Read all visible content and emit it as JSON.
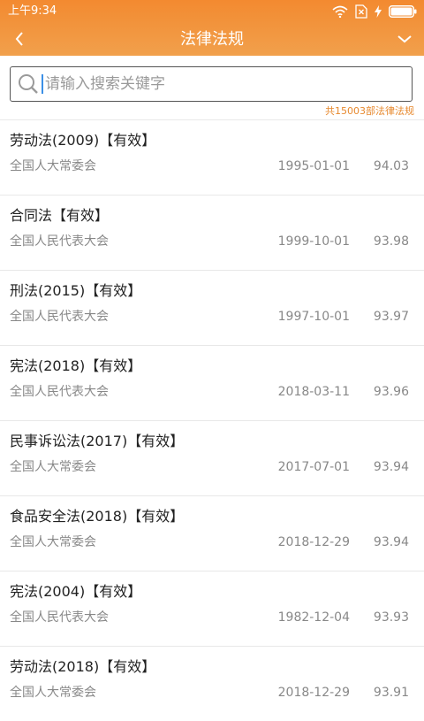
{
  "status_bar": {
    "time": "上午9:34",
    "icons": [
      "wifi-icon",
      "sim-error-icon",
      "charging-icon",
      "battery-icon"
    ]
  },
  "header": {
    "title": "法律法规",
    "back_icon": "chevron-left-icon",
    "menu_icon": "chevron-down-icon"
  },
  "search": {
    "placeholder": "请输入搜索关键字",
    "value": ""
  },
  "total_count": "共15003部法律法规",
  "colors": {
    "header_top": "#f38a30",
    "header_bottom": "#f1a04c",
    "accent": "#e7892e",
    "caret": "#3b8fe6"
  },
  "laws": [
    {
      "title": "劳动法(2009)【有效】",
      "issuer": "全国人大常委会",
      "date": "1995-01-01",
      "score": "94.03"
    },
    {
      "title": "合同法【有效】",
      "issuer": "全国人民代表大会",
      "date": "1999-10-01",
      "score": "93.98"
    },
    {
      "title": "刑法(2015)【有效】",
      "issuer": "全国人民代表大会",
      "date": "1997-10-01",
      "score": "93.97"
    },
    {
      "title": "宪法(2018)【有效】",
      "issuer": "全国人民代表大会",
      "date": "2018-03-11",
      "score": "93.96"
    },
    {
      "title": "民事诉讼法(2017)【有效】",
      "issuer": "全国人大常委会",
      "date": "2017-07-01",
      "score": "93.94"
    },
    {
      "title": "食品安全法(2018)【有效】",
      "issuer": "全国人大常委会",
      "date": "2018-12-29",
      "score": "93.94"
    },
    {
      "title": "宪法(2004)【有效】",
      "issuer": "全国人民代表大会",
      "date": "1982-12-04",
      "score": "93.93"
    },
    {
      "title": "劳动法(2018)【有效】",
      "issuer": "全国人大常委会",
      "date": "2018-12-29",
      "score": "93.91"
    }
  ]
}
